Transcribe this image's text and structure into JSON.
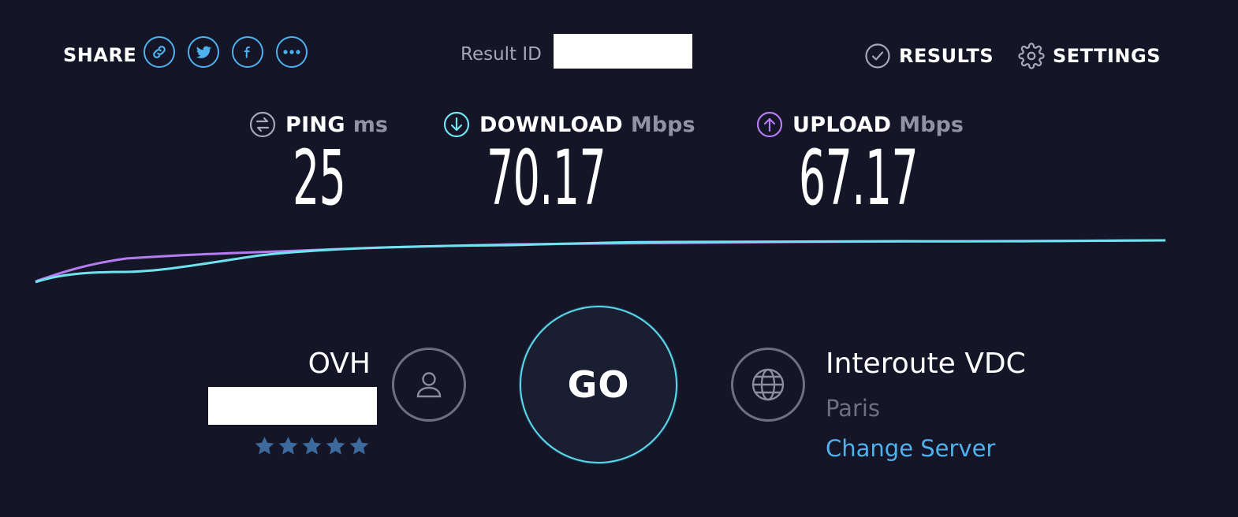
{
  "header": {
    "share_label": "SHARE",
    "share_buttons": [
      {
        "icon": "link-icon"
      },
      {
        "icon": "twitter-icon"
      },
      {
        "icon": "facebook-icon"
      },
      {
        "icon": "more-icon"
      }
    ],
    "result_id_label": "Result ID",
    "results_label": "RESULTS",
    "settings_label": "SETTINGS"
  },
  "metrics": {
    "ping": {
      "name": "PING",
      "unit": "ms",
      "value": "25",
      "icon": "ping-icon"
    },
    "download": {
      "name": "DOWNLOAD",
      "unit": "Mbps",
      "value": "70.17",
      "icon": "download-icon"
    },
    "upload": {
      "name": "UPLOAD",
      "unit": "Mbps",
      "value": "67.17",
      "icon": "upload-icon"
    }
  },
  "isp": {
    "name": "OVH",
    "rating_stars": 5,
    "icon": "user-icon"
  },
  "go_label": "GO",
  "server": {
    "name": "Interoute VDC",
    "location": "Paris",
    "change_label": "Change Server",
    "icon": "globe-icon"
  },
  "colors": {
    "background": "#141526",
    "accent_blue": "#4fb1ee",
    "download_cyan": "#6fe3ee",
    "upload_purple": "#b57cf2",
    "muted": "#6d7083",
    "star": "#3c6a9d"
  }
}
